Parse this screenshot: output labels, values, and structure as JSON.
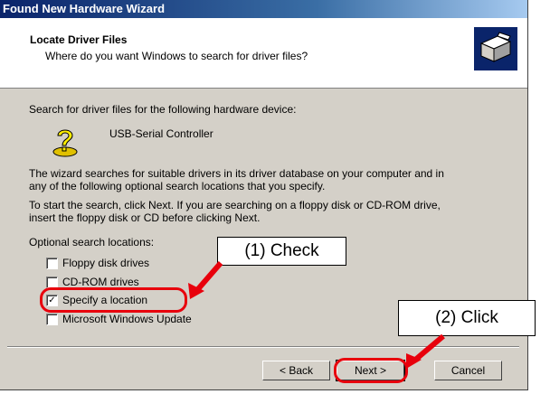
{
  "window": {
    "title": "Found New Hardware Wizard"
  },
  "header": {
    "title": "Locate Driver Files",
    "subtitle": "Where do you want Windows to search for driver files?",
    "icon": "hardware-wizard-icon"
  },
  "body": {
    "intro": "Search for driver files for the following hardware device:",
    "device_icon": "question-mark-icon",
    "device_name": "USB-Serial Controller",
    "para1_line1": "The wizard searches for suitable drivers in its driver database on your computer and in",
    "para1_line2": "any of the following optional search locations that you specify.",
    "para2_line1": "To start the search, click Next. If you are searching on a floppy disk or CD-ROM drive,",
    "para2_line2": "insert the floppy disk or CD before clicking Next.",
    "optional_label": "Optional search locations:"
  },
  "options": [
    {
      "label": "Floppy disk drives",
      "checked": false
    },
    {
      "label": "CD-ROM drives",
      "checked": false
    },
    {
      "label": "Specify a location",
      "checked": true
    },
    {
      "label": "Microsoft Windows Update",
      "checked": false
    }
  ],
  "buttons": {
    "back": "< Back",
    "next": "Next >",
    "cancel": "Cancel"
  },
  "annotations": {
    "check": "(1) Check",
    "click": "(2) Click",
    "color": "#e8000c"
  }
}
